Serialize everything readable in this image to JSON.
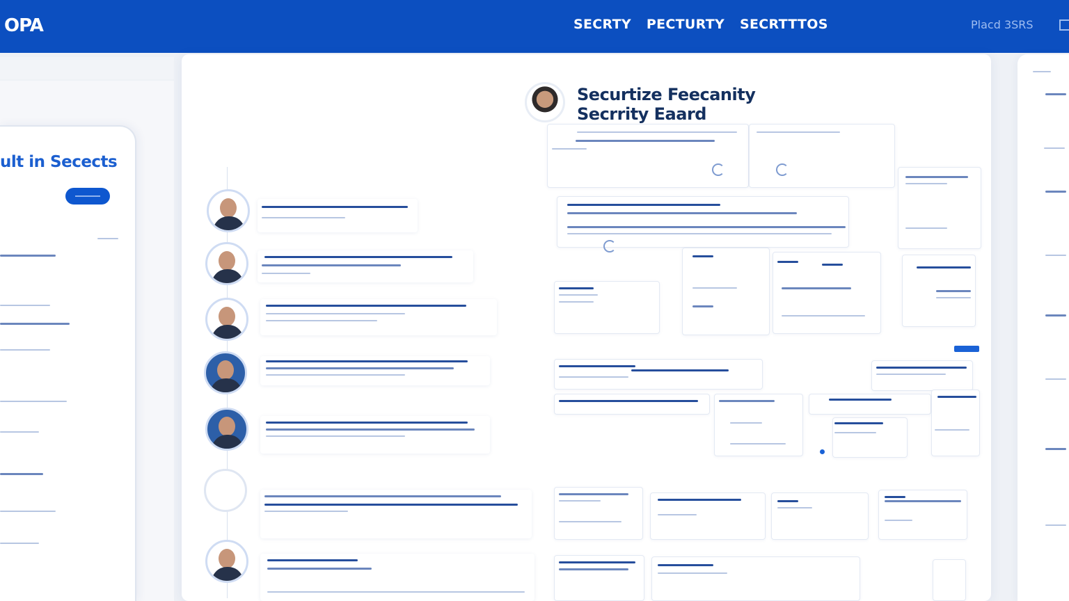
{
  "header": {
    "brand": "OPA",
    "nav": [
      "SECRTY",
      "PECTURTY",
      "SECRTTTOS"
    ],
    "right_label": "Placd 3SRS",
    "bg_color": "#0c4fc0"
  },
  "left_panel": {
    "phone_title": "ult in Secects"
  },
  "main": {
    "title_line1": "Securtize Feecanity",
    "title_line2": "Secrrity Eaard"
  },
  "icons": {
    "hero_avatar": "person-avatar",
    "timeline_avatars": "person-avatar"
  },
  "colors": {
    "accent": "#1a62d6",
    "text_dark": "#14305f",
    "surface": "#ffffff",
    "background": "#eef1f6"
  }
}
